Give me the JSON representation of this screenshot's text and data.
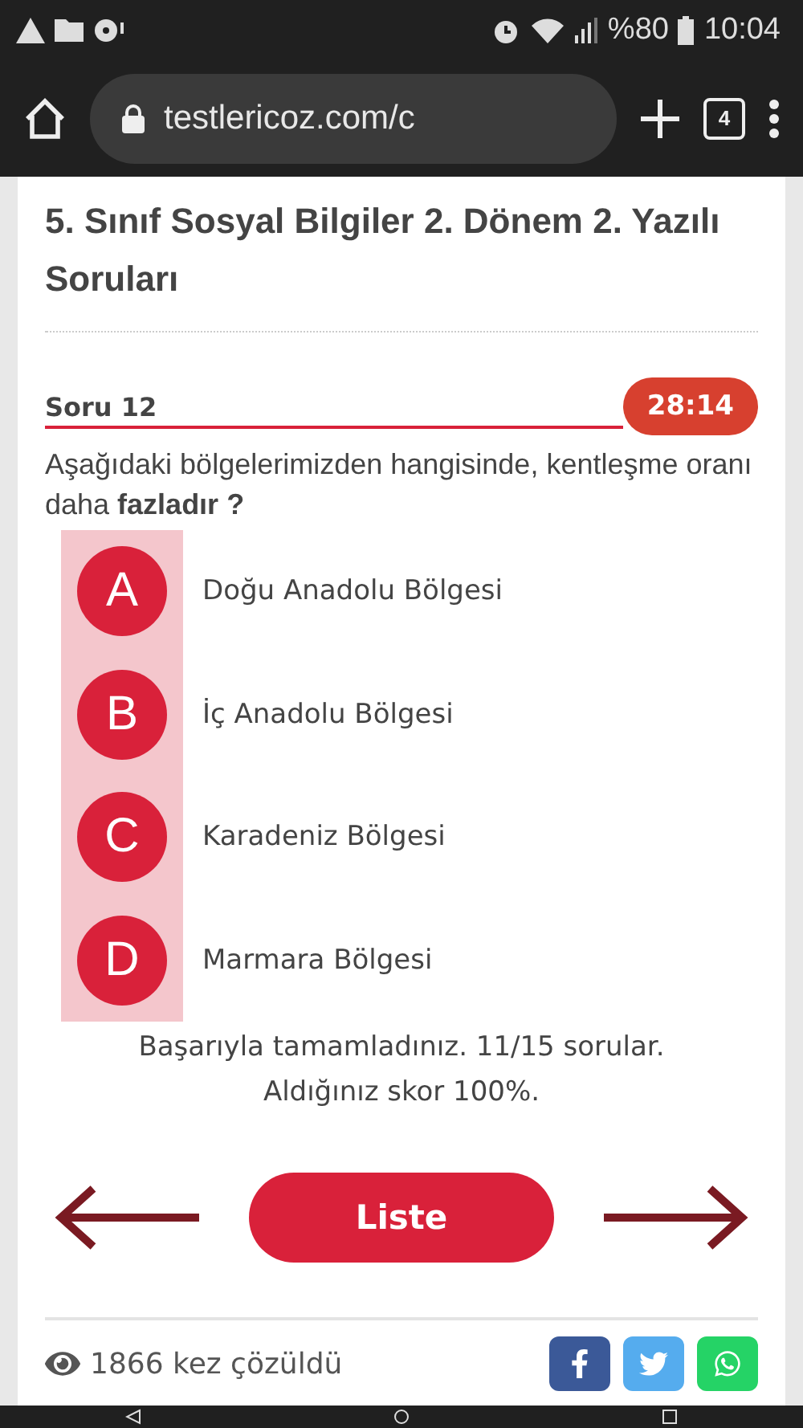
{
  "status_bar": {
    "battery": "%80",
    "time": "10:04"
  },
  "browser": {
    "url": "testlericoz.com/c",
    "tab_count": "4"
  },
  "title": "5. Sınıf Sosyal Bilgiler 2. Dönem 2. Yazılı Soruları",
  "question": {
    "label": "Soru 12",
    "timer": "28:14",
    "text": "Aşağıdaki bölgelerimizden hangisinde, kentleşme oranı daha **fazladır ?**"
  },
  "options": [
    {
      "letter": "A",
      "text": "Doğu Anadolu Bölgesi"
    },
    {
      "letter": "B",
      "text": "İç Anadolu Bölgesi"
    },
    {
      "letter": "C",
      "text": "Karadeniz Bölgesi"
    },
    {
      "letter": "D",
      "text": "Marmara Bölgesi"
    }
  ],
  "result": [
    "Başarıyla tamamladınız. 11/15 sorular.",
    "Aldığınız skor 100%."
  ],
  "list_button": "Liste",
  "footer": {
    "views": "1866 kez çözüldü"
  }
}
